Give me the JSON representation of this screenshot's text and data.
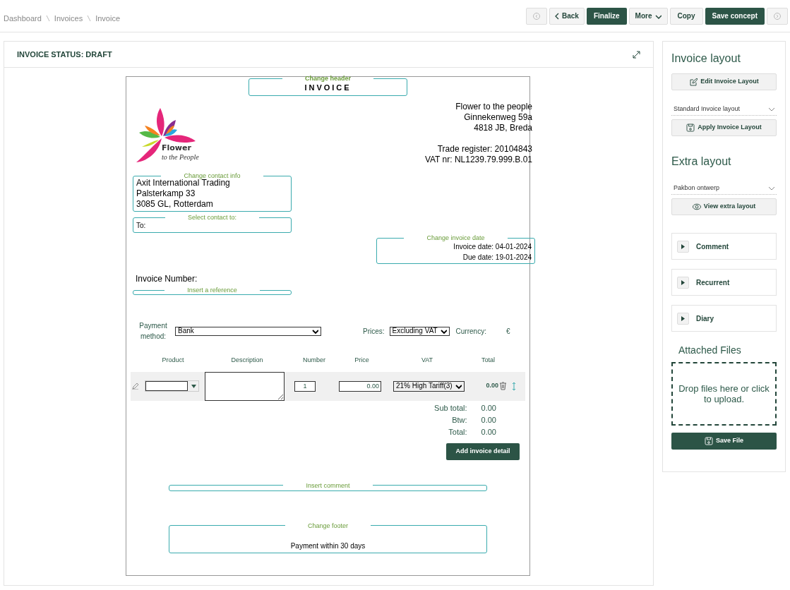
{
  "breadcrumb": [
    "Dashboard",
    "Invoices",
    "Invoice"
  ],
  "toolbar": [
    {
      "kind": "prev"
    },
    {
      "kind": "back",
      "label": "Back"
    },
    {
      "kind": "primary",
      "label": "Finalize"
    },
    {
      "kind": "menu",
      "label": "More"
    },
    {
      "kind": "default",
      "label": "Copy"
    },
    {
      "kind": "primary",
      "label": "Save concept"
    },
    {
      "kind": "next"
    }
  ],
  "panel": {
    "title": "INVOICE STATUS: DRAFT"
  },
  "invoice": {
    "header": {
      "legend": "Change header",
      "title": "INVOICE"
    },
    "logo": {
      "name": "Flower",
      "tagline": "to the People"
    },
    "company": {
      "address": [
        "Flower to the people",
        "Ginnekenweg 59a",
        "4818 JB, Breda"
      ],
      "registration": [
        "Trade register: 20104843",
        "VAT nr: NL1239.79.999.B.01"
      ]
    },
    "contact": {
      "legend": "Change contact info",
      "lines": [
        "Axit International Trading",
        "Palsterkamp 33",
        "3085 GL, Rotterdam"
      ]
    },
    "contact_to": {
      "legend": "Select contact to:",
      "label": "To:"
    },
    "dates": {
      "legend": "Change invoice date",
      "lines": [
        "Invoice date: 04-01-2024",
        "Due date: 19-01-2024"
      ]
    },
    "invoice_number_label": "Invoice Number:",
    "reference": {
      "legend": "Insert a reference"
    },
    "payment": {
      "label": "Payment method:",
      "value": "Bank"
    },
    "prices": {
      "label": "Prices:",
      "value": "Excluding VAT"
    },
    "currency": {
      "label": "Currency:",
      "value": "€"
    },
    "columns": [
      "Product",
      "Description",
      "Number",
      "Price",
      "VAT",
      "Total"
    ],
    "rows": [
      {
        "number": "1",
        "price": "0.00",
        "vat": "21% High Tariff(3)",
        "total": "0.00"
      }
    ],
    "totals": [
      {
        "label": "Sub total:",
        "value": "0.00"
      },
      {
        "label": "Btw:",
        "value": "0.00"
      },
      {
        "label": "Total:",
        "value": "0.00"
      }
    ],
    "add_button": "Add invoice detail",
    "comment": {
      "legend": "Insert comment"
    },
    "footer": {
      "legend": "Change footer",
      "text": "Payment within 30 days"
    }
  },
  "sidebar": {
    "invoice_layout": {
      "title": "Invoice layout",
      "edit_button": "Edit Invoice Layout",
      "select_value": "Standard Invoice layout",
      "apply_button": "Apply Invoice Layout"
    },
    "extra_layout": {
      "title": "Extra layout",
      "select_value": "Pakbon ontwerp",
      "view_button": "View extra layout"
    },
    "sections": [
      {
        "label": "Comment",
        "expanded": false
      },
      {
        "label": "Recurrent",
        "expanded": false
      },
      {
        "label": "Diary",
        "expanded": false
      }
    ],
    "attached_files": {
      "title": "Attached Files",
      "dropzone_text": "Drop files here or click to upload.",
      "save_button": "Save File"
    }
  }
}
